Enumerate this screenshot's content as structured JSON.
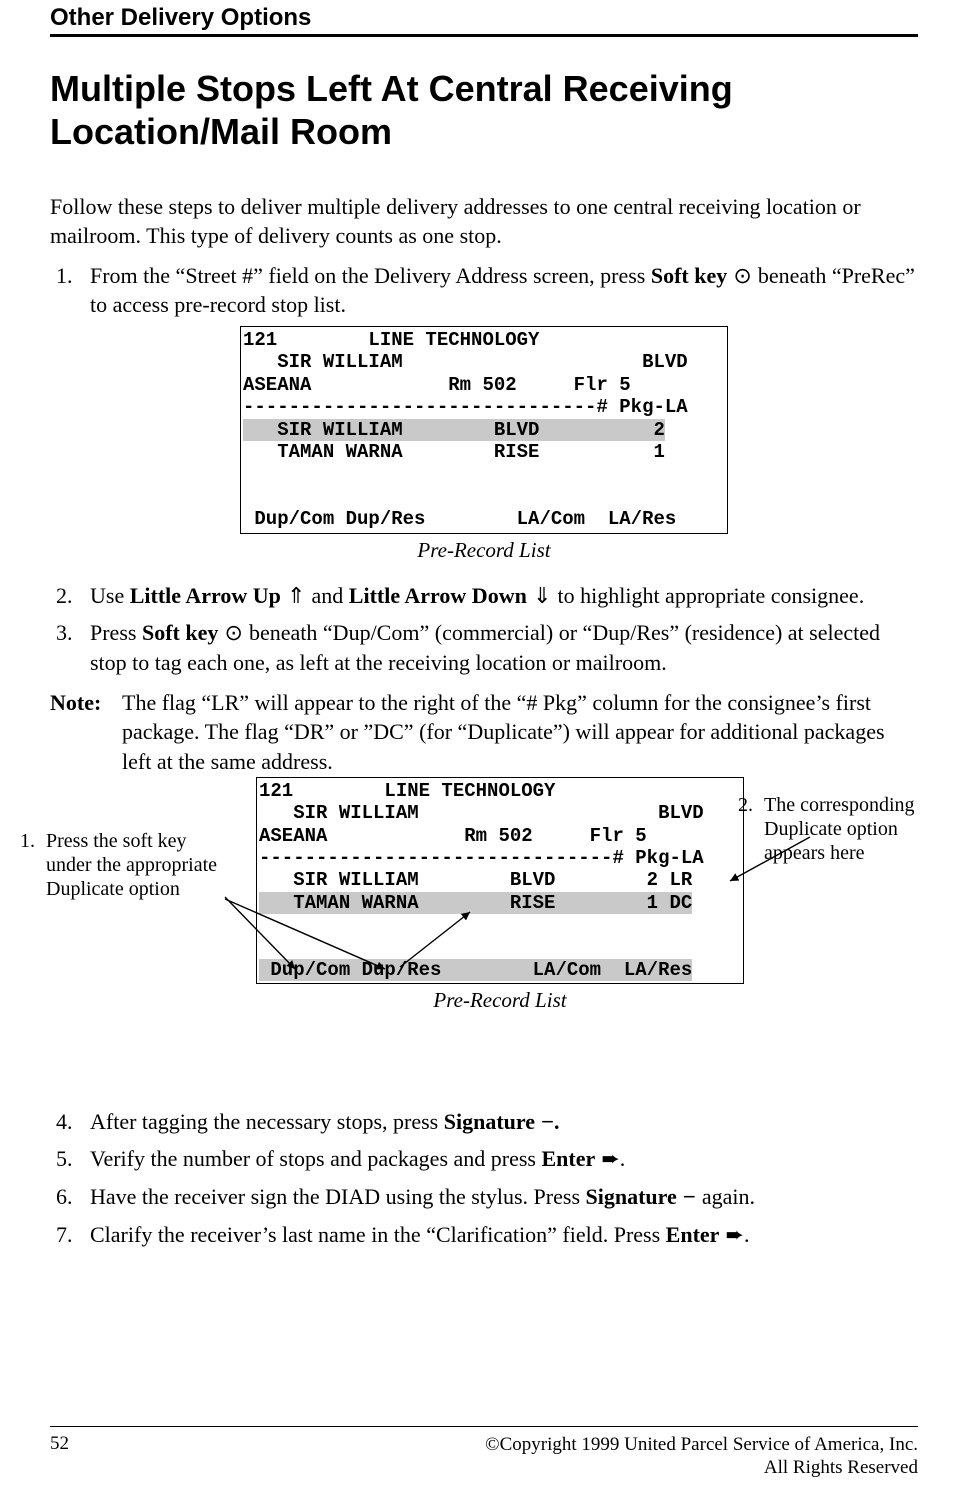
{
  "header": {
    "running": "Other Delivery Options"
  },
  "title": "Multiple Stops Left At Central Receiving Location/Mail Room",
  "intro": "Follow these steps to deliver multiple delivery addresses to one central receiving location or mailroom. This type of delivery counts as one stop.",
  "steps": {
    "s1a": "From the “Street #” field on the Delivery Address screen, press ",
    "s1_soft": "Soft key",
    "s1_sym": " ⊙ ",
    "s1b": "beneath “PreRec” to access pre-record stop list.",
    "s2a": "Use ",
    "s2_u": "Little Arrow Up",
    "s2_usym": " ⇑ ",
    "s2b": " and ",
    "s2_d": "Little Arrow Down",
    "s2_dsym": " ⇓ ",
    "s2c": " to highlight appropriate consignee.",
    "s3a": "Press ",
    "s3_soft": "Soft key",
    "s3_sym": " ⊙ ",
    "s3b": "beneath “Dup/Com” (commercial) or “Dup/Res” (residence) at selected stop to tag each one, as left at the receiving location or mailroom.",
    "s4a": "After tagging the necessary stops, press ",
    "s4_sig": "Signature",
    "s4_sym": " −",
    "s4_dot": ".",
    "s5a": "Verify the number of stops and packages and press ",
    "s5_ent": "Enter",
    "s5_sym": " ➨",
    "s5_dot": ".",
    "s6a": "Have the receiver sign the DIAD using the stylus. Press ",
    "s6_sig": "Signature",
    "s6_sym": " − ",
    "s6b": "again.",
    "s7a": "Clarify the receiver’s last name in the “Clarification” field. Press ",
    "s7_ent": "Enter",
    "s7_sym": " ➨",
    "s7_dot": "."
  },
  "note": {
    "label": "Note:",
    "body": "The flag “LR” will appear to the right of the “# Pkg” column for the consignee’s first package. The flag “DR” or ”DC” (for “Duplicate”) will appear for additional packages left at the same address."
  },
  "screen1": {
    "l1": "121        LINE TECHNOLOGY",
    "l2": "   SIR WILLIAM                     BLVD",
    "l3": "ASEANA            Rm 502     Flr 5",
    "l4": "-------------------------------# Pkg-LA",
    "l5": "   SIR WILLIAM        BLVD          2",
    "l6": "   TAMAN WARNA        RISE          1",
    "l7": "",
    "l8": "",
    "l9": " Dup/Com Dup/Res        LA/Com  LA/Res"
  },
  "screen2": {
    "l1": "121        LINE TECHNOLOGY",
    "l2": "   SIR WILLIAM                     BLVD",
    "l3": "ASEANA            Rm 502     Flr 5",
    "l4": "-------------------------------# Pkg-LA",
    "l5": "   SIR WILLIAM        BLVD        2 LR",
    "l6": "   TAMAN WARNA        RISE        1 DC",
    "l7": "",
    "l8": "",
    "l9": " Dup/Com Dup/Res        LA/Com  LA/Res"
  },
  "caption": "Pre-Record List",
  "annot": {
    "left_num": "1.",
    "left": "Press the soft key under the appropriate Duplicate option",
    "right_num": "2.",
    "right": "The corresponding Duplicate option appears here"
  },
  "footer": {
    "page": "52",
    "copy1": "©Copyright 1999 United Parcel Service of America, Inc.",
    "copy2": "All Rights Reserved"
  }
}
